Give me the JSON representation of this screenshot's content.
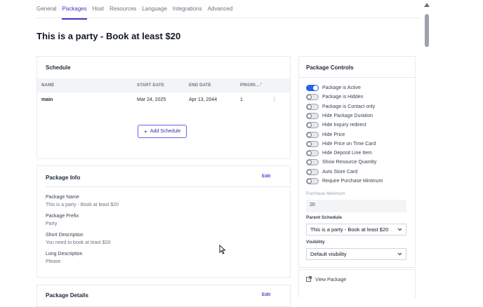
{
  "tabs": [
    "General",
    "Packages",
    "Host",
    "Resources",
    "Language",
    "Integrations",
    "Advanced"
  ],
  "active_tab": "Packages",
  "page_title": "This is a party - Book at least $20",
  "schedule": {
    "title": "Schedule",
    "columns": [
      "NAME",
      "START DATE",
      "END DATE",
      "PRIORI..."
    ],
    "sort_indicator": "↑",
    "rows": [
      {
        "name": "main",
        "start": "Mar 24, 2025",
        "end": "Apr 13, 2044",
        "priority": "1",
        "menu": "⋮"
      }
    ],
    "add_label": "Add Schedule",
    "add_icon": "+"
  },
  "info": {
    "title": "Package Info",
    "edit": "Edit",
    "fields": [
      {
        "label": "Package Name",
        "value": "This is a party - Book at least $20"
      },
      {
        "label": "Package Prefix",
        "value": "Party"
      },
      {
        "label": "Short Description",
        "value": "You need to book at least $20"
      },
      {
        "label": "Long Description",
        "value": "Please"
      }
    ]
  },
  "details": {
    "title": "Package Details",
    "edit": "Edit"
  },
  "controls": {
    "title": "Package Controls",
    "toggles": [
      {
        "label": "Package is Active",
        "on": true
      },
      {
        "label": "Package is Hidden",
        "on": false
      },
      {
        "label": "Package is Contact only",
        "on": false
      },
      {
        "label": "Hide Package Duration",
        "on": false
      },
      {
        "label": "Hide Inquiry redirect",
        "on": false
      },
      {
        "label": "Hide Price",
        "on": false
      },
      {
        "label": "Hide Price on Time Card",
        "on": false
      },
      {
        "label": "Hide Deposit Line Item",
        "on": false
      },
      {
        "label": "Show Resource Quantity",
        "on": false
      },
      {
        "label": "Auto Store Card",
        "on": false
      },
      {
        "label": "Require Purchase Minimum",
        "on": false
      }
    ],
    "purchase_minimum_label": "Purchase Minimum",
    "purchase_minimum_value": "20",
    "parent_schedule_label": "Parent Schedule",
    "parent_schedule_value": "This is a party - Book at least $20",
    "visibility_label": "Visibility",
    "visibility_value": "Default visibility",
    "view_package": "View Package"
  },
  "colors": {
    "accent": "#4338ca",
    "toggle_on": "#2563eb"
  }
}
